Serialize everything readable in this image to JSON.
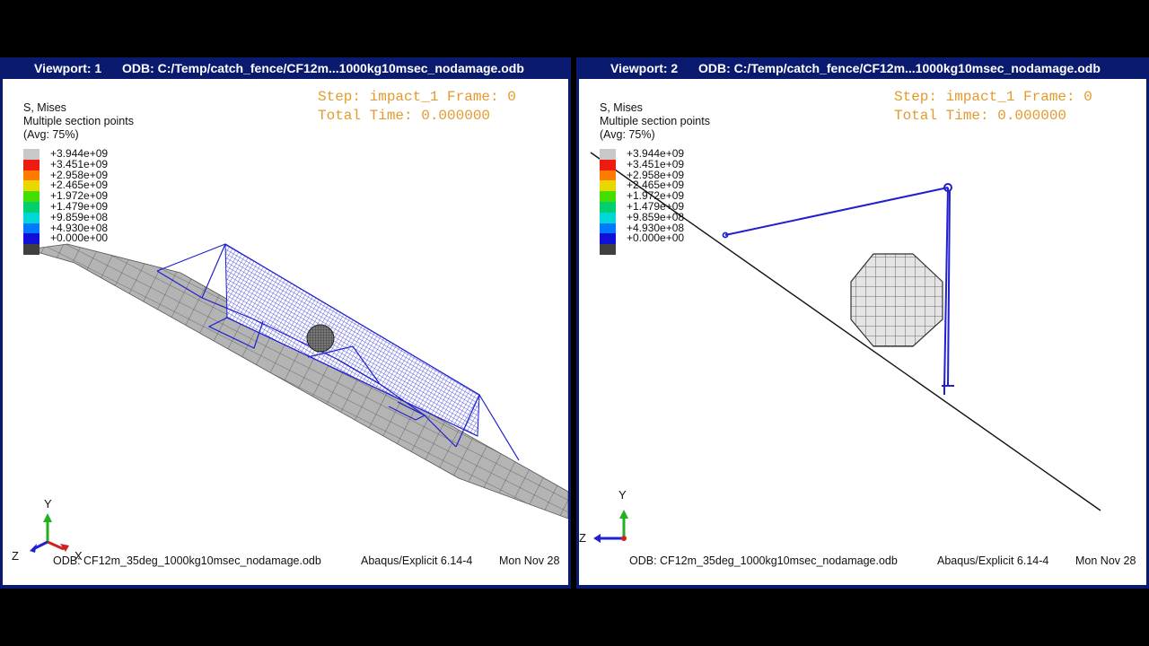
{
  "legend": {
    "title_lines": [
      "S, Mises",
      "Multiple section points",
      "(Avg: 75%)"
    ],
    "entries": [
      {
        "label": "+3.944e+09",
        "color": "#c8c8c8"
      },
      {
        "label": "+3.451e+09",
        "color": "#ee1c10"
      },
      {
        "label": "+2.958e+09",
        "color": "#ff7a00"
      },
      {
        "label": "+2.465e+09",
        "color": "#e8d800"
      },
      {
        "label": "+1.972e+09",
        "color": "#44dd00"
      },
      {
        "label": "+1.479e+09",
        "color": "#00d070"
      },
      {
        "label": "+9.859e+08",
        "color": "#00d8d8"
      },
      {
        "label": "+4.930e+08",
        "color": "#0078ff"
      },
      {
        "label": "+0.000e+00",
        "color": "#1010d8"
      }
    ],
    "bottom_color": "#404040"
  },
  "viewports": [
    {
      "name": "Viewport: 1",
      "odb_path": "ODB: C:/Temp/catch_fence/CF12m...1000kg10msec_nodamage.odb",
      "step_line": "Step: impact_1 Frame: 0",
      "time_line": "Total Time: 0.000000",
      "odb_footer": "ODB: CF12m_35deg_1000kg10msec_nodamage.odb",
      "solver": "Abaqus/Explicit 6.14-4",
      "date": "Mon Nov 28",
      "triad": {
        "y": "Y",
        "z": "Z",
        "x": "X"
      }
    },
    {
      "name": "Viewport: 2",
      "odb_path": "ODB: C:/Temp/catch_fence/CF12m...1000kg10msec_nodamage.odb",
      "step_line": "Step: impact_1 Frame: 0",
      "time_line": "Total Time: 0.000000",
      "odb_footer": "ODB: CF12m_35deg_1000kg10msec_nodamage.odb",
      "solver": "Abaqus/Explicit 6.14-4",
      "date": "Mon Nov 28",
      "triad": {
        "y": "Y",
        "z": "Z"
      }
    }
  ],
  "colors": {
    "titlebar": "#0a1a6e",
    "step_text": "#e39a2e",
    "mesh_blue": "#2020d0",
    "slope_gray": "#b0b0b0"
  }
}
